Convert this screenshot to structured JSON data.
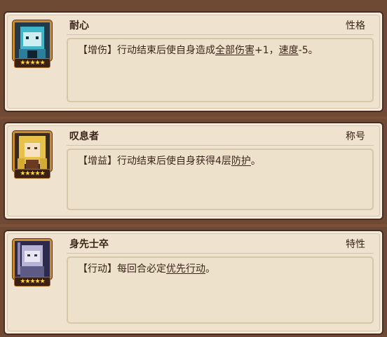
{
  "cards": [
    {
      "name": "耐心",
      "tag": "性格",
      "stars": "★★★★★",
      "desc": {
        "prefix": "【增伤】行动结束后使自身造成",
        "link1": "全部伤害",
        "mid": "+1，",
        "link2": "速度",
        "suffix": "-5。"
      },
      "portrait_color": "#3fb6c9"
    },
    {
      "name": "叹息者",
      "tag": "称号",
      "stars": "★★★★★",
      "desc": {
        "prefix": "【增益】行动结束后使自身获得4层",
        "link1": "防护",
        "suffix": "。"
      },
      "portrait_color": "#e7c24a"
    },
    {
      "name": "身先士卒",
      "tag": "特性",
      "stars": "★★★★★",
      "desc": {
        "prefix": "【行动】每回合必定",
        "link1": "优先行动",
        "suffix": "。"
      },
      "portrait_color": "#b7b2d6"
    }
  ]
}
